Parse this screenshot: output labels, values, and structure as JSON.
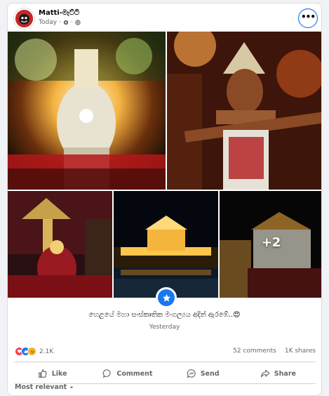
{
  "post": {
    "page_name": "Matti-මැට්ටි",
    "time": "Today",
    "caption": "හෙළයේ මහා සංස්කෘතික මංගල්‍යය අදින් ඇරඹේ..😍",
    "caption_date": "Yesterday",
    "more_photos": "+2"
  },
  "stats": {
    "reaction_count": "2.1K",
    "comments": "52 comments",
    "shares": "1K shares"
  },
  "actions": {
    "like": "Like",
    "comment": "Comment",
    "send": "Send",
    "share": "Share"
  },
  "sort": {
    "label": "Most relevant"
  },
  "colors": {
    "brand": "#1877f2",
    "like": "#1877f2",
    "love": "#f33e58",
    "haha": "#f7b125"
  },
  "icons": [
    "more-icon",
    "globe-icon",
    "settings-icon",
    "like-icon",
    "comment-icon",
    "send-icon",
    "share-icon",
    "chevron-down-icon",
    "star-badge-icon"
  ]
}
